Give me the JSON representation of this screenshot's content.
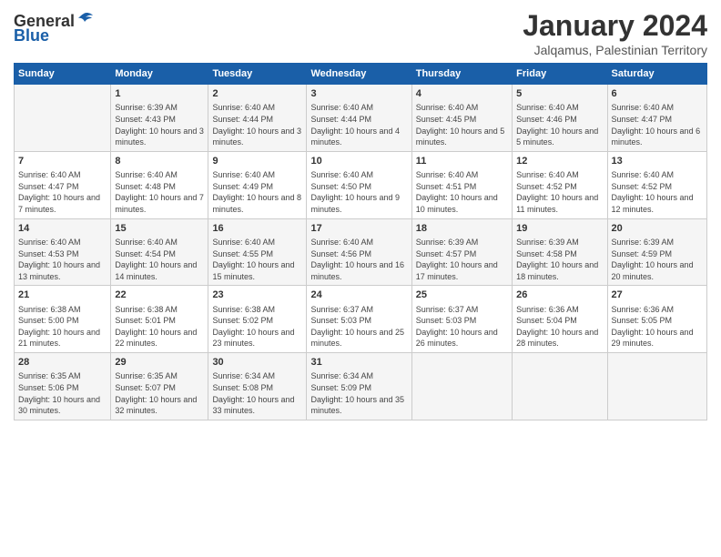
{
  "logo": {
    "general": "General",
    "blue": "Blue"
  },
  "title": "January 2024",
  "subtitle": "Jalqamus, Palestinian Territory",
  "days": [
    "Sunday",
    "Monday",
    "Tuesday",
    "Wednesday",
    "Thursday",
    "Friday",
    "Saturday"
  ],
  "weeks": [
    [
      {
        "date": "",
        "sunrise": "",
        "sunset": "",
        "daylight": ""
      },
      {
        "date": "1",
        "sunrise": "Sunrise: 6:39 AM",
        "sunset": "Sunset: 4:43 PM",
        "daylight": "Daylight: 10 hours and 3 minutes."
      },
      {
        "date": "2",
        "sunrise": "Sunrise: 6:40 AM",
        "sunset": "Sunset: 4:44 PM",
        "daylight": "Daylight: 10 hours and 3 minutes."
      },
      {
        "date": "3",
        "sunrise": "Sunrise: 6:40 AM",
        "sunset": "Sunset: 4:44 PM",
        "daylight": "Daylight: 10 hours and 4 minutes."
      },
      {
        "date": "4",
        "sunrise": "Sunrise: 6:40 AM",
        "sunset": "Sunset: 4:45 PM",
        "daylight": "Daylight: 10 hours and 5 minutes."
      },
      {
        "date": "5",
        "sunrise": "Sunrise: 6:40 AM",
        "sunset": "Sunset: 4:46 PM",
        "daylight": "Daylight: 10 hours and 5 minutes."
      },
      {
        "date": "6",
        "sunrise": "Sunrise: 6:40 AM",
        "sunset": "Sunset: 4:47 PM",
        "daylight": "Daylight: 10 hours and 6 minutes."
      }
    ],
    [
      {
        "date": "7",
        "sunrise": "Sunrise: 6:40 AM",
        "sunset": "Sunset: 4:47 PM",
        "daylight": "Daylight: 10 hours and 7 minutes."
      },
      {
        "date": "8",
        "sunrise": "Sunrise: 6:40 AM",
        "sunset": "Sunset: 4:48 PM",
        "daylight": "Daylight: 10 hours and 7 minutes."
      },
      {
        "date": "9",
        "sunrise": "Sunrise: 6:40 AM",
        "sunset": "Sunset: 4:49 PM",
        "daylight": "Daylight: 10 hours and 8 minutes."
      },
      {
        "date": "10",
        "sunrise": "Sunrise: 6:40 AM",
        "sunset": "Sunset: 4:50 PM",
        "daylight": "Daylight: 10 hours and 9 minutes."
      },
      {
        "date": "11",
        "sunrise": "Sunrise: 6:40 AM",
        "sunset": "Sunset: 4:51 PM",
        "daylight": "Daylight: 10 hours and 10 minutes."
      },
      {
        "date": "12",
        "sunrise": "Sunrise: 6:40 AM",
        "sunset": "Sunset: 4:52 PM",
        "daylight": "Daylight: 10 hours and 11 minutes."
      },
      {
        "date": "13",
        "sunrise": "Sunrise: 6:40 AM",
        "sunset": "Sunset: 4:52 PM",
        "daylight": "Daylight: 10 hours and 12 minutes."
      }
    ],
    [
      {
        "date": "14",
        "sunrise": "Sunrise: 6:40 AM",
        "sunset": "Sunset: 4:53 PM",
        "daylight": "Daylight: 10 hours and 13 minutes."
      },
      {
        "date": "15",
        "sunrise": "Sunrise: 6:40 AM",
        "sunset": "Sunset: 4:54 PM",
        "daylight": "Daylight: 10 hours and 14 minutes."
      },
      {
        "date": "16",
        "sunrise": "Sunrise: 6:40 AM",
        "sunset": "Sunset: 4:55 PM",
        "daylight": "Daylight: 10 hours and 15 minutes."
      },
      {
        "date": "17",
        "sunrise": "Sunrise: 6:40 AM",
        "sunset": "Sunset: 4:56 PM",
        "daylight": "Daylight: 10 hours and 16 minutes."
      },
      {
        "date": "18",
        "sunrise": "Sunrise: 6:39 AM",
        "sunset": "Sunset: 4:57 PM",
        "daylight": "Daylight: 10 hours and 17 minutes."
      },
      {
        "date": "19",
        "sunrise": "Sunrise: 6:39 AM",
        "sunset": "Sunset: 4:58 PM",
        "daylight": "Daylight: 10 hours and 18 minutes."
      },
      {
        "date": "20",
        "sunrise": "Sunrise: 6:39 AM",
        "sunset": "Sunset: 4:59 PM",
        "daylight": "Daylight: 10 hours and 20 minutes."
      }
    ],
    [
      {
        "date": "21",
        "sunrise": "Sunrise: 6:38 AM",
        "sunset": "Sunset: 5:00 PM",
        "daylight": "Daylight: 10 hours and 21 minutes."
      },
      {
        "date": "22",
        "sunrise": "Sunrise: 6:38 AM",
        "sunset": "Sunset: 5:01 PM",
        "daylight": "Daylight: 10 hours and 22 minutes."
      },
      {
        "date": "23",
        "sunrise": "Sunrise: 6:38 AM",
        "sunset": "Sunset: 5:02 PM",
        "daylight": "Daylight: 10 hours and 23 minutes."
      },
      {
        "date": "24",
        "sunrise": "Sunrise: 6:37 AM",
        "sunset": "Sunset: 5:03 PM",
        "daylight": "Daylight: 10 hours and 25 minutes."
      },
      {
        "date": "25",
        "sunrise": "Sunrise: 6:37 AM",
        "sunset": "Sunset: 5:03 PM",
        "daylight": "Daylight: 10 hours and 26 minutes."
      },
      {
        "date": "26",
        "sunrise": "Sunrise: 6:36 AM",
        "sunset": "Sunset: 5:04 PM",
        "daylight": "Daylight: 10 hours and 28 minutes."
      },
      {
        "date": "27",
        "sunrise": "Sunrise: 6:36 AM",
        "sunset": "Sunset: 5:05 PM",
        "daylight": "Daylight: 10 hours and 29 minutes."
      }
    ],
    [
      {
        "date": "28",
        "sunrise": "Sunrise: 6:35 AM",
        "sunset": "Sunset: 5:06 PM",
        "daylight": "Daylight: 10 hours and 30 minutes."
      },
      {
        "date": "29",
        "sunrise": "Sunrise: 6:35 AM",
        "sunset": "Sunset: 5:07 PM",
        "daylight": "Daylight: 10 hours and 32 minutes."
      },
      {
        "date": "30",
        "sunrise": "Sunrise: 6:34 AM",
        "sunset": "Sunset: 5:08 PM",
        "daylight": "Daylight: 10 hours and 33 minutes."
      },
      {
        "date": "31",
        "sunrise": "Sunrise: 6:34 AM",
        "sunset": "Sunset: 5:09 PM",
        "daylight": "Daylight: 10 hours and 35 minutes."
      },
      {
        "date": "",
        "sunrise": "",
        "sunset": "",
        "daylight": ""
      },
      {
        "date": "",
        "sunrise": "",
        "sunset": "",
        "daylight": ""
      },
      {
        "date": "",
        "sunrise": "",
        "sunset": "",
        "daylight": ""
      }
    ]
  ]
}
